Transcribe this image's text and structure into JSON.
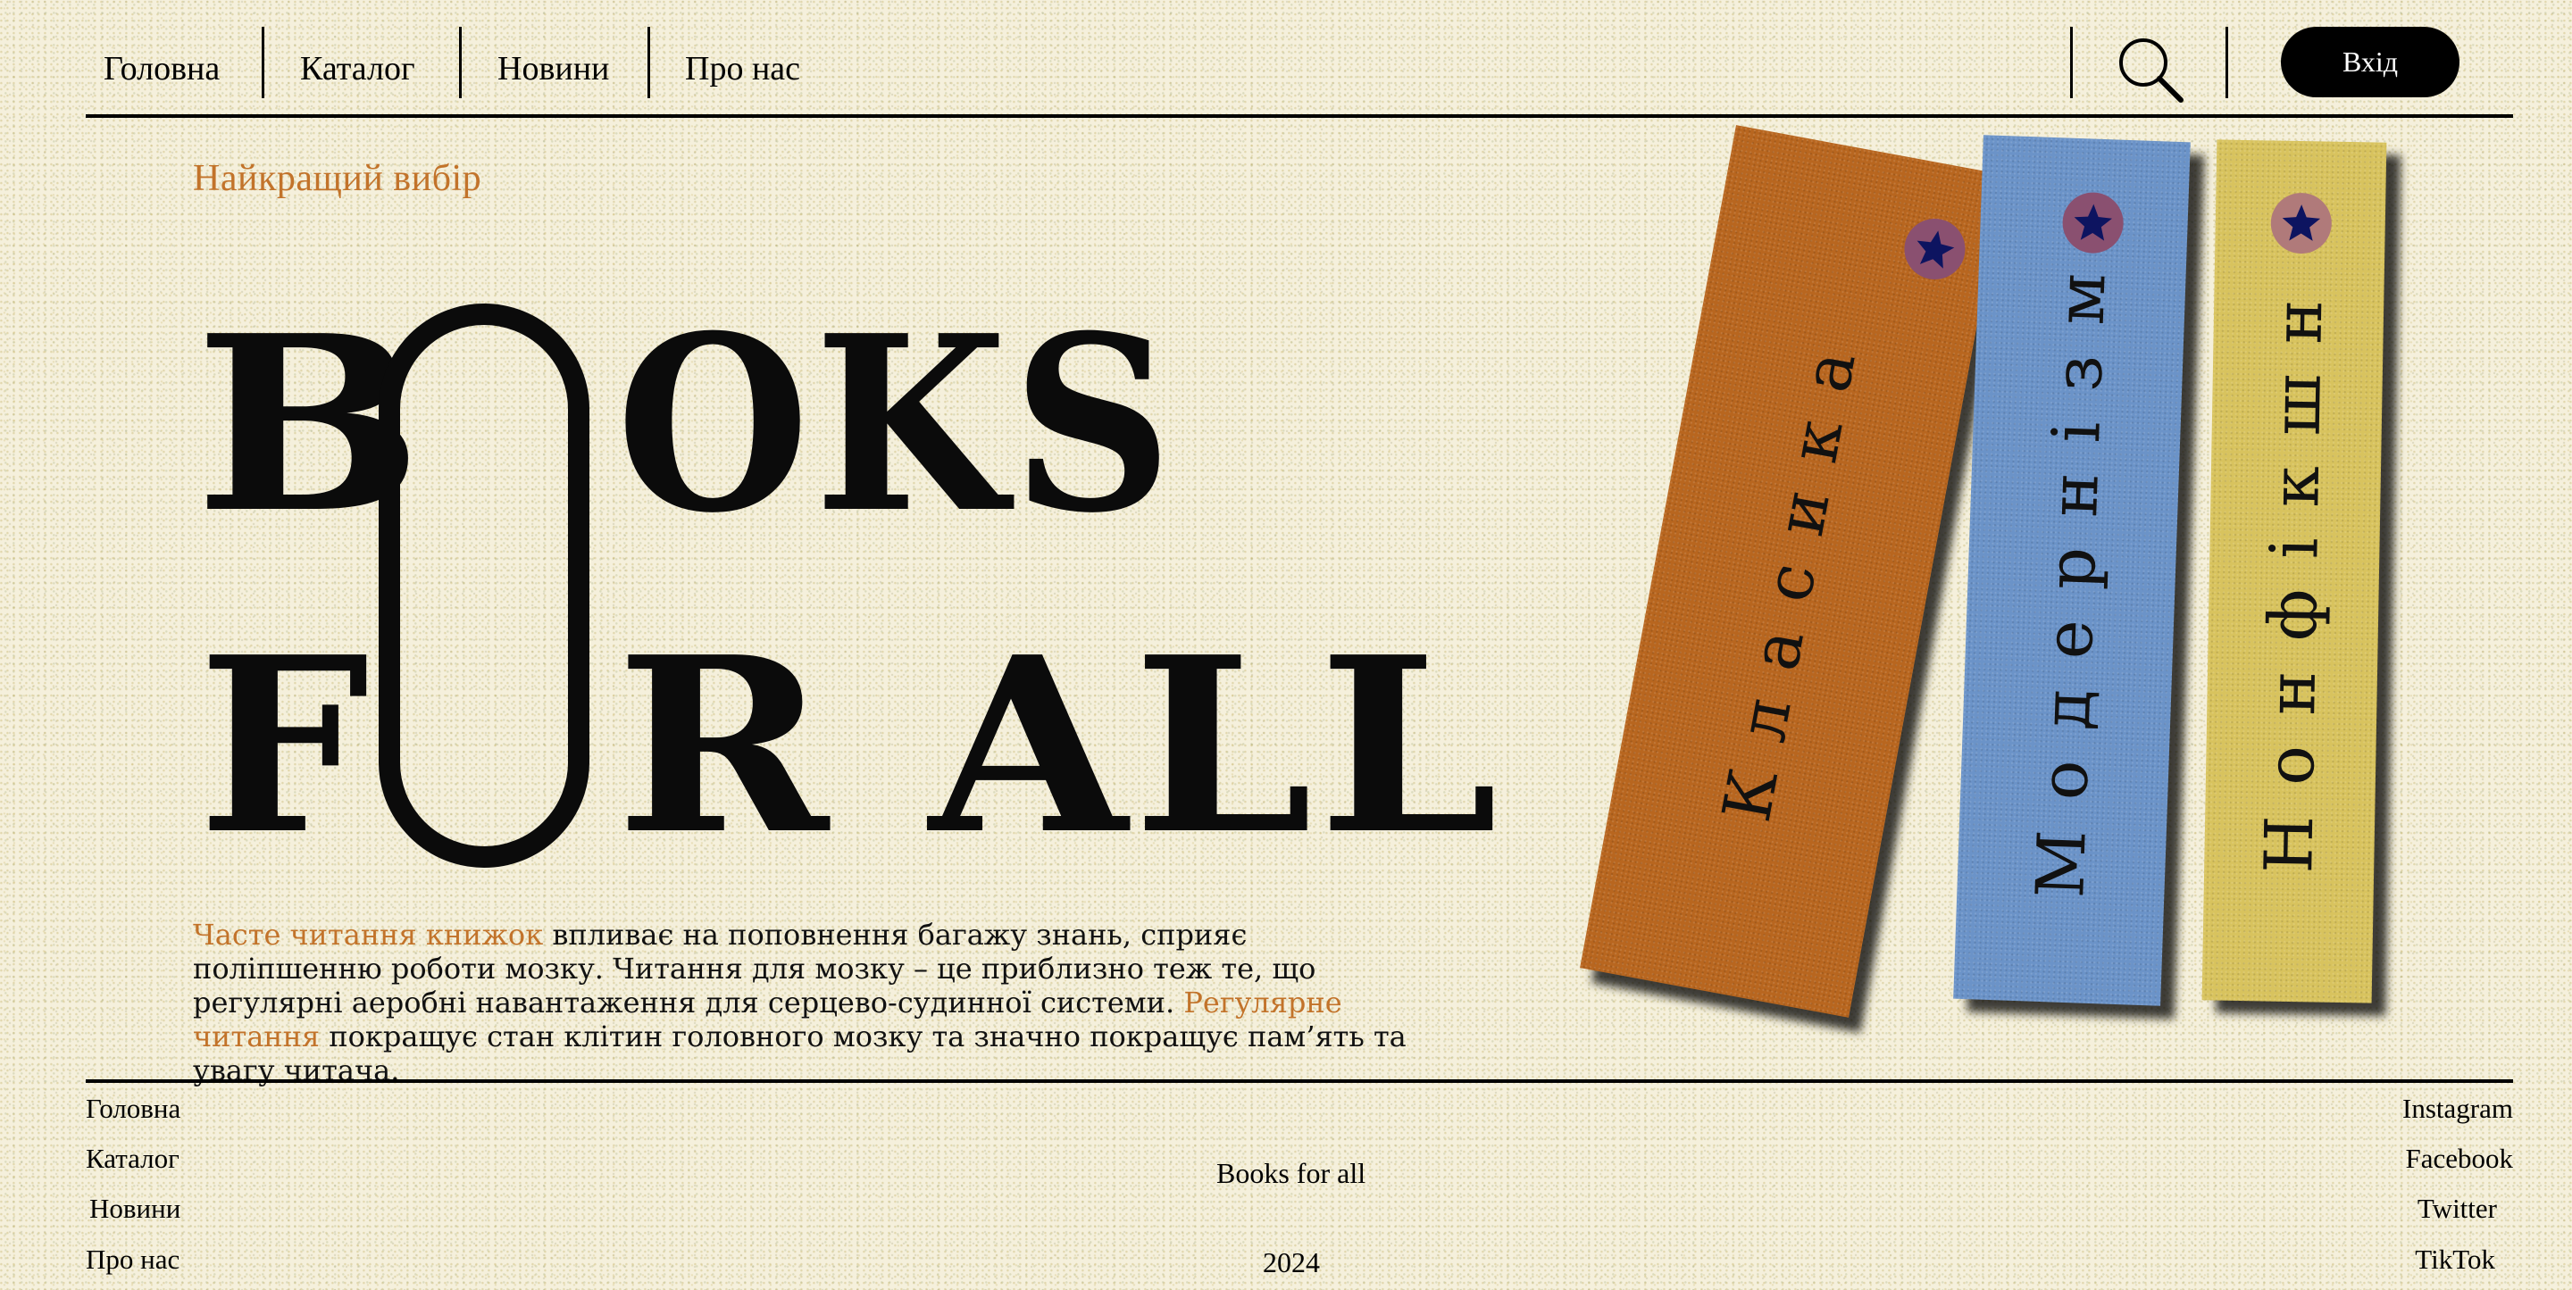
{
  "nav": {
    "items": [
      {
        "label": "Головна"
      },
      {
        "label": "Каталог"
      },
      {
        "label": "Новини"
      },
      {
        "label": "Про нас"
      }
    ],
    "search_icon": "search-icon",
    "login_label": "Вхід"
  },
  "hero": {
    "tagline": "Найкращий вибір",
    "line1": "B",
    "line1_rest": "OKS",
    "line2": "F",
    "line2_rest": "R ALL",
    "paragraph": {
      "accent1": "Часте читання книжок",
      "text1": " впливає на поповнення багажу знань, сприяє поліпшенню роботи мозку. Читання для мозку – це приблизно теж те, що регулярні аеробні навантаження для серцево-судинної системи. ",
      "accent2": "Регулярне читання",
      "text2": " покращує стан клітин головного мозку та значно покращує пам’ять та увагу читача."
    }
  },
  "books": [
    {
      "label": "Класика",
      "color": "#b8661f",
      "star_bg": "#8a5070"
    },
    {
      "label": "Модернізм",
      "color": "#6b93c8",
      "star_bg": "#8a5070"
    },
    {
      "label": "Нонфікшн",
      "color": "#d8c35e",
      "star_bg": "#b07a7a"
    }
  ],
  "star_color": "#0d1460",
  "footer": {
    "left_links": [
      "Головна",
      "Каталог",
      "Новини",
      "Про нас"
    ],
    "center_title": "Books for all",
    "year": "2024",
    "right_links": [
      "Instagram",
      "Facebook",
      "Twitter",
      "TikTok"
    ]
  }
}
